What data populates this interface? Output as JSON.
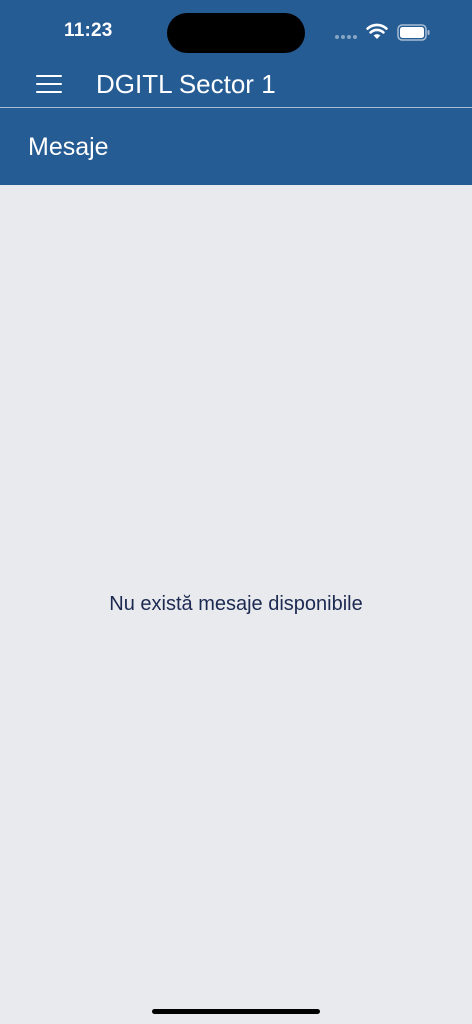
{
  "status_bar": {
    "time": "11:23",
    "icons": [
      "signal-icon",
      "wifi-icon",
      "battery-icon"
    ]
  },
  "toolbar": {
    "menu_icon": "hamburger-menu-icon",
    "app_title": "DGITL Sector 1"
  },
  "section": {
    "title": "Mesaje"
  },
  "main": {
    "empty_message": "Nu există mesaje disponibile"
  },
  "colors": {
    "header_bg": "#265c94",
    "page_bg": "#e9eaed",
    "message_text": "#1c2951",
    "header_text": "#ffffff"
  }
}
